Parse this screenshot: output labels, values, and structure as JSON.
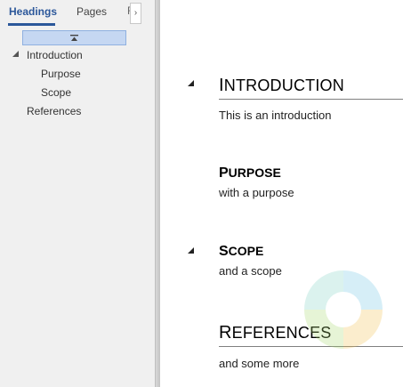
{
  "nav": {
    "tabs": [
      "Headings",
      "Pages",
      "R"
    ],
    "tree": [
      {
        "label": "Introduction",
        "level": 1,
        "expanded": true
      },
      {
        "label": "Purpose",
        "level": 2
      },
      {
        "label": "Scope",
        "level": 2
      },
      {
        "label": "References",
        "level": 1
      }
    ]
  },
  "document": {
    "sections": [
      {
        "heading_first": "I",
        "heading_rest": "NTRODUCTION",
        "level": 1,
        "body": "This is an introduction"
      },
      {
        "heading_first": "P",
        "heading_rest": "URPOSE",
        "level": 2,
        "body": "with a purpose"
      },
      {
        "heading_first": "S",
        "heading_rest": "COPE",
        "level": 2,
        "body": "and a scope"
      },
      {
        "heading_first": "R",
        "heading_rest": "EFERENCES",
        "level": 1,
        "body": "and some more"
      }
    ]
  },
  "colors": {
    "accent": "#2b579a",
    "selection": "#c5d7f2",
    "pane_background": "#f0f0f0"
  },
  "icons": {
    "collapse_all": "collapse-all-icon",
    "expanded": "expanded-triangle-icon",
    "scroll_tabs": "chevron-right-icon"
  }
}
